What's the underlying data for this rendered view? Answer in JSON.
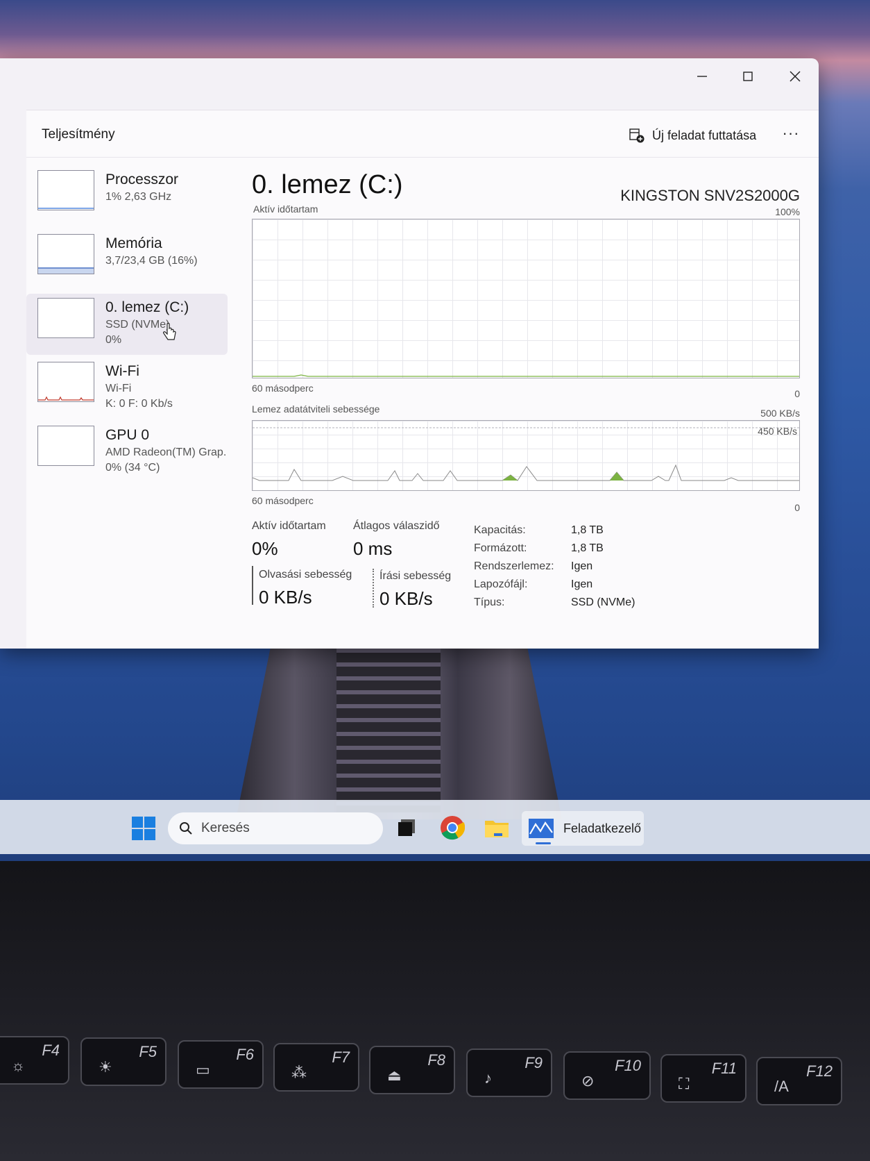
{
  "window": {
    "title_section": "Teljesítmény",
    "run_task_label": "Új feladat futtatása",
    "more_label": "···"
  },
  "sidebar": {
    "items": [
      {
        "name": "Processzor",
        "sub1": "1%  2,63 GHz",
        "sub2": ""
      },
      {
        "name": "Memória",
        "sub1": "3,7/23,4 GB (16%)",
        "sub2": ""
      },
      {
        "name": "0. lemez (C:)",
        "sub1": "SSD (NVMe)",
        "sub2": "0%"
      },
      {
        "name": "Wi-Fi",
        "sub1": "Wi-Fi",
        "sub2": "K: 0  F: 0 Kb/s"
      },
      {
        "name": "GPU 0",
        "sub1": "AMD Radeon(TM) Grap.",
        "sub2": "0%  (34 °C)"
      }
    ],
    "memory_fill": 0.16
  },
  "disk": {
    "title": "0. lemez (C:)",
    "model": "KINGSTON SNV2S2000G",
    "graph1": {
      "label": "Aktív időtartam",
      "max": "100%",
      "xlabel": "60 másodperc",
      "min": "0"
    },
    "graph2": {
      "label": "Lemez adatátviteli sebessége",
      "max": "500 KB/s",
      "secondary": "450 KB/s",
      "xlabel": "60 másodperc",
      "min": "0"
    },
    "stats": {
      "active_label": "Aktív időtartam",
      "active_value": "0%",
      "response_label": "Átlagos válaszidő",
      "response_value": "0 ms",
      "read_label": "Olvasási sebesség",
      "read_value": "0 KB/s",
      "write_label": "Írási sebesség",
      "write_value": "0 KB/s"
    },
    "props": [
      {
        "label": "Kapacitás:",
        "value": "1,8 TB"
      },
      {
        "label": "Formázott:",
        "value": "1,8 TB"
      },
      {
        "label": "Rendszerlemez:",
        "value": "Igen"
      },
      {
        "label": "Lapozófájl:",
        "value": "Igen"
      },
      {
        "label": "Típus:",
        "value": "SSD (NVMe)"
      }
    ]
  },
  "taskbar": {
    "search_placeholder": "Keresés",
    "active_app": "Feladatkezelő"
  },
  "keyboard": {
    "fkeys": [
      "F4",
      "F5",
      "F6",
      "F7",
      "F8",
      "F9",
      "F10",
      "F11",
      "F12"
    ]
  },
  "colors": {
    "accent": "#2f6fd6",
    "disk_graph": "#7cb342",
    "memory": "#6e8fd0",
    "wifi": "#c0392b"
  }
}
